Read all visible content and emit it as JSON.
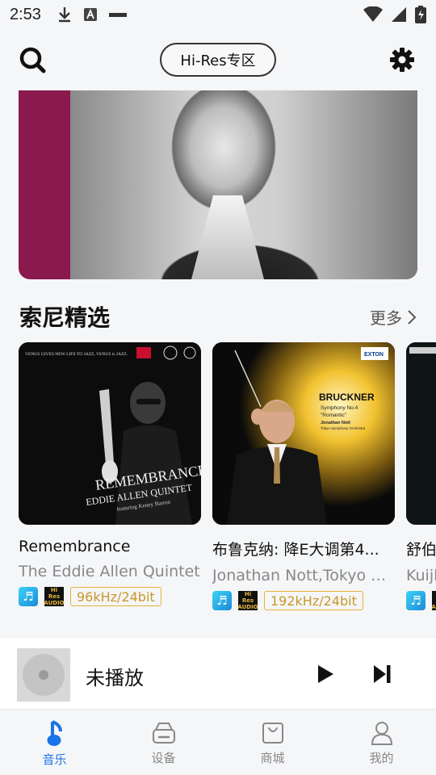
{
  "status_bar": {
    "time": "2:53"
  },
  "header": {
    "hires_label": "Hi-Res专区"
  },
  "section": {
    "title": "索尼精选",
    "more_label": "更多"
  },
  "albums": [
    {
      "title": "Remembrance",
      "artist": "The Eddie Allen Quintet",
      "rate": "96kHz/24bit"
    },
    {
      "title": "布鲁克纳: 降E大调第4...",
      "artist": "Jonathan Nott,Tokyo Sy...",
      "rate": "192kHz/24bit"
    },
    {
      "title": "舒伯",
      "artist": "Kuijl",
      "rate": ""
    }
  ],
  "covers": {
    "remembrance": {
      "top_text": "VENUS GIVES NEW LIFE TO JAZZ, VENUS is JAZZ.",
      "title": "REMEMBRANCE",
      "subtitle": "EDDIE ALLEN QUINTET",
      "featuring": "featuring Kenny Barron"
    },
    "bruckner": {
      "label": "EXTON",
      "composer": "BRUCKNER",
      "work": "Symphony No.4",
      "nickname": "\"Romantic\"",
      "conductor": "Jonathan Nott",
      "orchestra": "Tokyo Symphony Orchestra"
    }
  },
  "badges": {
    "hires_line1": "Hi",
    "hires_line2": "Res",
    "hires_line3": "AUDIO"
  },
  "player": {
    "title": "未播放"
  },
  "tabs": [
    {
      "label": "音乐",
      "icon": "music-note-icon"
    },
    {
      "label": "设备",
      "icon": "device-icon"
    },
    {
      "label": "商城",
      "icon": "shopping-bag-icon"
    },
    {
      "label": "我的",
      "icon": "person-icon"
    }
  ],
  "colors": {
    "accent": "#1a73e8",
    "hires_gold": "#e2b43a",
    "banner_magenta": "#8a1a4e"
  }
}
